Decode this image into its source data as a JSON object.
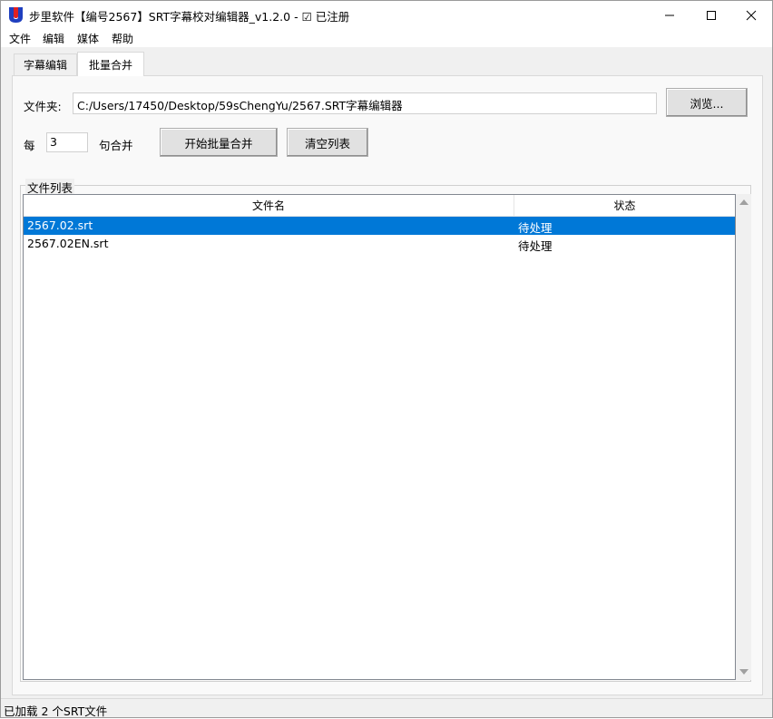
{
  "window": {
    "title": "步里软件【编号2567】SRT字幕校对编辑器_v1.2.0 - ☑ 已注册"
  },
  "menu": {
    "items": [
      "文件",
      "编辑",
      "媒体",
      "帮助"
    ]
  },
  "tabs": [
    {
      "label": "字幕编辑",
      "active": false
    },
    {
      "label": "批量合并",
      "active": true
    }
  ],
  "folder": {
    "label": "文件夹:",
    "value": "C:/Users/17450/Desktop/59sChengYu/2567.SRT字幕编辑器",
    "browse_label": "浏览..."
  },
  "merge": {
    "prefix": "每",
    "count": "3",
    "suffix": "句合并",
    "start_label": "开始批量合并",
    "clear_label": "清空列表"
  },
  "file_list": {
    "group_title": "文件列表",
    "columns": [
      "文件名",
      "状态"
    ],
    "rows": [
      {
        "name": "2567.02.srt",
        "status": "待处理",
        "selected": true
      },
      {
        "name": "2567.02EN.srt",
        "status": "待处理",
        "selected": false
      }
    ]
  },
  "status_bar": {
    "text": "已加载 2 个SRT文件"
  },
  "colors": {
    "selection": "#0078d7",
    "logo_blue": "#1f3fbf",
    "logo_red": "#e02020"
  }
}
